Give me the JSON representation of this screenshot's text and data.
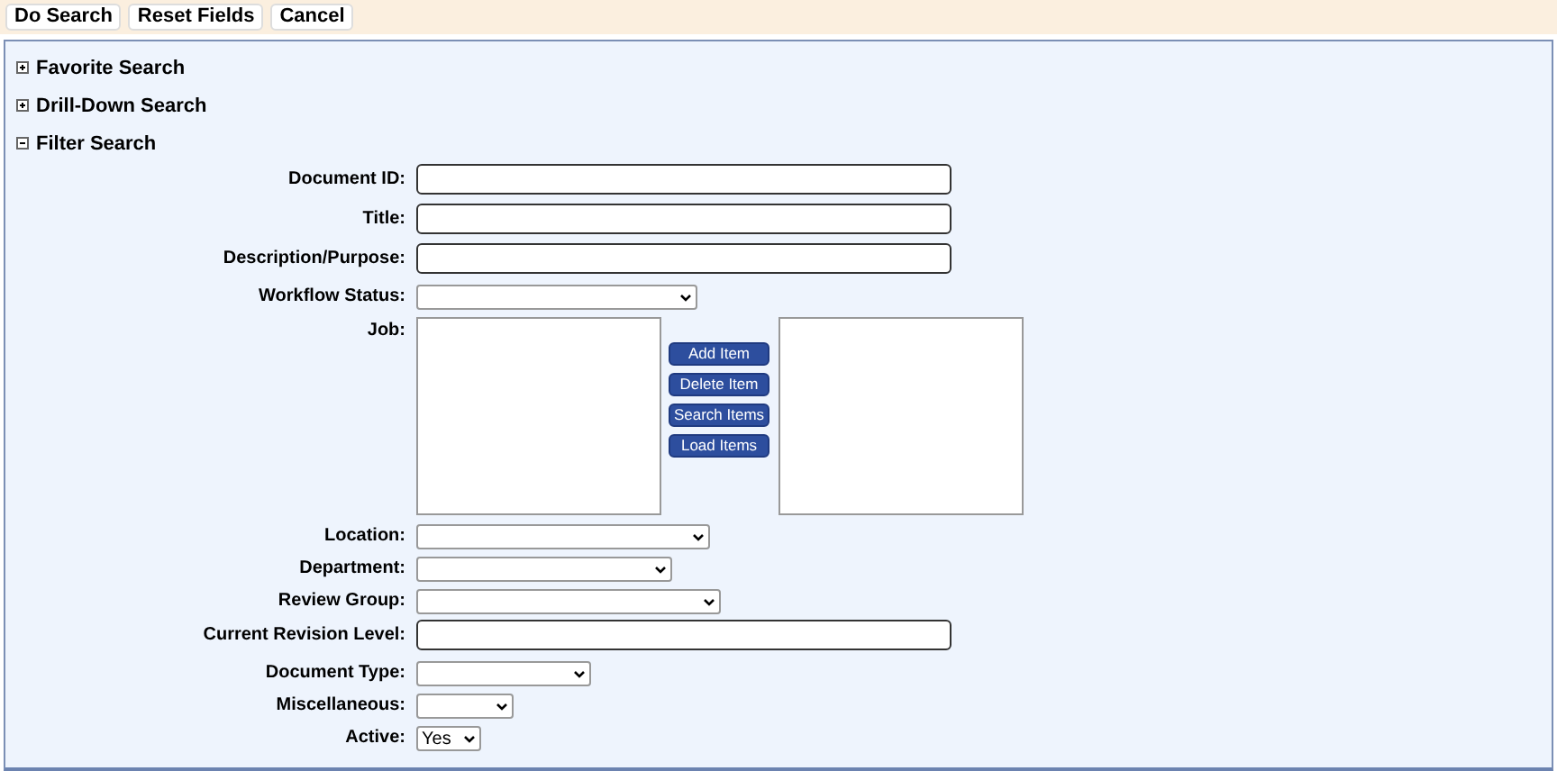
{
  "toolbar": {
    "buttons": [
      "Do Search",
      "Reset Fields",
      "Cancel"
    ]
  },
  "sections": [
    {
      "title": "Favorite Search",
      "expanded": false
    },
    {
      "title": "Drill-Down Search",
      "expanded": false
    },
    {
      "title": "Filter Search",
      "expanded": true
    }
  ],
  "fields": [
    {
      "kind": "text",
      "label": "Document ID:"
    },
    {
      "kind": "text",
      "label": "Title:"
    },
    {
      "kind": "text",
      "label": "Description/Purpose:"
    },
    {
      "kind": "select",
      "label": "Workflow Status:"
    },
    {
      "kind": "picker",
      "label": "Job:",
      "buttons": [
        "Add Item",
        "Delete Item",
        "Search Items",
        "Load Items"
      ]
    },
    {
      "kind": "select",
      "label": "Location:"
    },
    {
      "kind": "select",
      "label": "Department:"
    },
    {
      "kind": "select",
      "label": "Review Group:"
    },
    {
      "kind": "text",
      "label": "Current Revision Level:"
    },
    {
      "kind": "select",
      "label": "Document Type:"
    },
    {
      "kind": "select",
      "label": "Miscellaneous:"
    },
    {
      "kind": "select",
      "label": "Active:",
      "value": "Yes"
    }
  ]
}
